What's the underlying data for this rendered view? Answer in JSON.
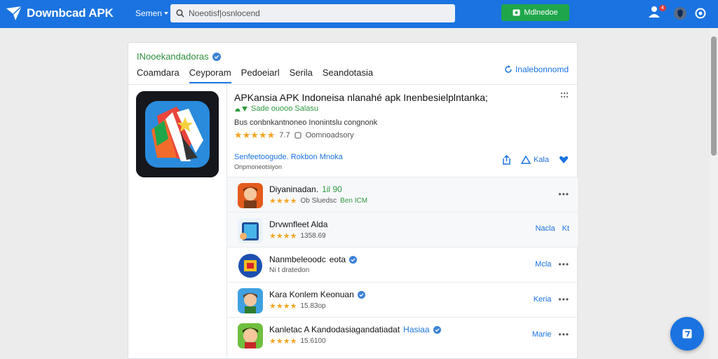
{
  "topbar": {
    "logo_text": "Downbcad APK",
    "section_label": "Semen",
    "search_placeholder": "Noeotisf|osnlocend",
    "download_label": "Mdlnedoe",
    "notif_count": "4"
  },
  "card": {
    "store_name": "INooekandadoras",
    "tabs": [
      "Coamdara",
      "Ceyporam",
      "Pedoeiarl",
      "Serila",
      "Seandotasia"
    ],
    "active_tab_index": 1,
    "head_action": "Inalebonnomd"
  },
  "app": {
    "title": "APKansia APK Indoneisa nlanahé apk Inenbesielplntanka;",
    "subtitle": "Sade ouooo Salasu",
    "description": "Bus conbnkantnoneo Inonintslu congnonk",
    "rating_value": "7.7",
    "rating_label": "Oomnoadsory",
    "links": "Senfeetoogude. Rokbon Mnoka",
    "note": "Onpmoneotsiyon",
    "actions": {
      "compare": "Kala"
    }
  },
  "list": [
    {
      "title": "Diyaninadan.",
      "title_extra": "1il 90",
      "sub_pre": "Ob Sluedsc",
      "sub_extra": "Ben ICM",
      "action": "",
      "verified": false
    },
    {
      "title": "Drvwnfleet Alda",
      "sub_pre": "1358.69",
      "action": "Nacla",
      "action_extra": "Kt",
      "verified": false
    },
    {
      "title": "Nanmbeleoodc",
      "title_extra": "eota",
      "sub_pre": "Ni t dratedon",
      "action": "Mcla",
      "verified": true
    },
    {
      "title": "Kara Konlem Keonuan",
      "sub_pre": "15.83op",
      "action": "Keria",
      "verified": true
    },
    {
      "title": "Kanletac A Kandodasiagandatiadat",
      "title_extra": "Hasiaa",
      "sub_pre": "15.6100",
      "action": "Marie",
      "verified": true
    }
  ],
  "colors": {
    "topbar": "#1a73e0",
    "accent_green": "#2d9a3e",
    "link_blue": "#1a73e0",
    "star": "#f4a522"
  }
}
